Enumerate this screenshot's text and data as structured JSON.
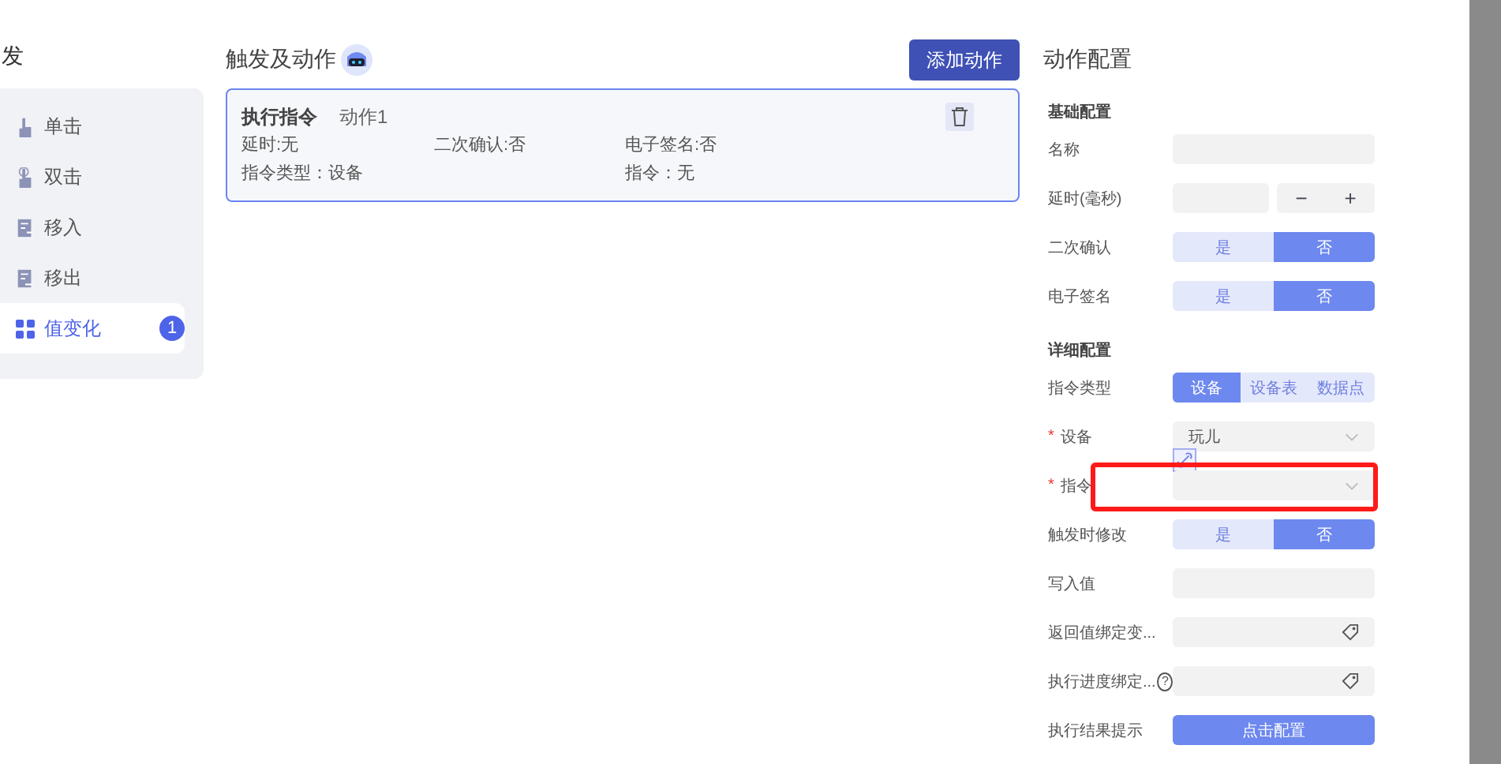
{
  "trigger_panel": {
    "title": "发",
    "items": [
      {
        "label": "单击",
        "kind": "tap",
        "selected": false
      },
      {
        "label": "双击",
        "kind": "double-tap",
        "selected": false
      },
      {
        "label": "移入",
        "kind": "doc-in",
        "selected": false
      },
      {
        "label": "移出",
        "kind": "doc-out",
        "selected": false
      },
      {
        "label": "值变化",
        "kind": "grid",
        "selected": true,
        "badge": "1"
      }
    ]
  },
  "actions": {
    "title": "触发及动作",
    "add_button": "添加动作",
    "cards": [
      {
        "type": "执行指令",
        "name": "动作1",
        "fields": [
          {
            "left": "延时:无",
            "middle": "二次确认:否",
            "right": "电子签名:否"
          },
          {
            "left": "指令类型：设备",
            "right": "指令：无"
          }
        ]
      }
    ]
  },
  "config": {
    "title": "动作配置",
    "sections": [
      {
        "title": "基础配置",
        "rows": [
          {
            "kind": "input",
            "label": "名称"
          },
          {
            "kind": "stepper",
            "label": "延时(毫秒)",
            "minus": "−",
            "plus": "+"
          },
          {
            "kind": "toggle",
            "label": "二次确认",
            "options": [
              {
                "label": "是",
                "selected": false
              },
              {
                "label": "否",
                "selected": true
              }
            ]
          },
          {
            "kind": "toggle",
            "label": "电子签名",
            "options": [
              {
                "label": "是",
                "selected": false
              },
              {
                "label": "否",
                "selected": true
              }
            ]
          }
        ]
      },
      {
        "title": "详细配置",
        "rows": [
          {
            "kind": "toggle",
            "label": "指令类型",
            "options": [
              {
                "label": "设备",
                "selected": true
              },
              {
                "label": "设备表",
                "selected": false
              },
              {
                "label": "数据点",
                "selected": false
              }
            ]
          },
          {
            "kind": "select",
            "label": "设备",
            "required": "*",
            "value": "玩儿"
          },
          {
            "kind": "select",
            "label": "指令",
            "required": "*",
            "highlighted": true
          },
          {
            "kind": "toggle",
            "label": "触发时修改",
            "options": [
              {
                "label": "是",
                "selected": false
              },
              {
                "label": "否",
                "selected": true
              }
            ]
          },
          {
            "kind": "input",
            "label": "写入值"
          },
          {
            "kind": "tag",
            "label": "返回值绑定变..."
          },
          {
            "kind": "tag",
            "label": "执行进度绑定...",
            "help": "?"
          },
          {
            "kind": "button",
            "label": "执行结果提示",
            "button": "点击配置"
          }
        ]
      }
    ]
  }
}
